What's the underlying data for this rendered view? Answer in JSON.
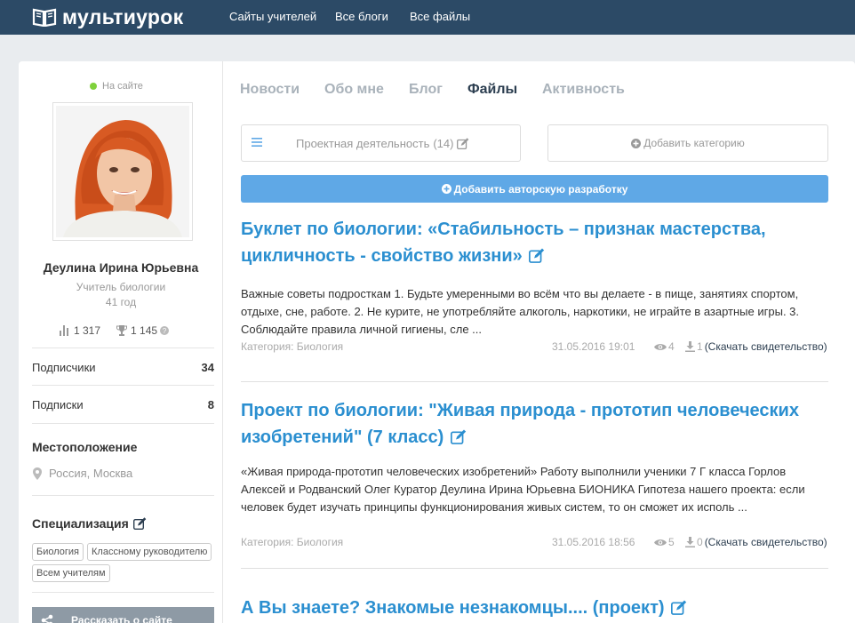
{
  "brand": {
    "name": "мультиурок"
  },
  "topnav": [
    "Сайты учителей",
    "Все блоги",
    "Все файлы"
  ],
  "profile": {
    "status": "На сайте",
    "name": "Деулина Ирина Юрьевна",
    "role": "Учитель биологии",
    "age": "41 год",
    "rating": "1 317",
    "awards": "1 145",
    "subscribers_label": "Подписчики",
    "subscribers": "34",
    "subscriptions_label": "Подписки",
    "subscriptions": "8",
    "location_heading": "Местоположение",
    "location": "Россия, Москва",
    "spec_heading": "Специализация",
    "spec_tags": [
      "Биология",
      "Классному руководителю",
      "Всем учителям"
    ],
    "share_label": "Рассказать о сайте"
  },
  "tabs": [
    "Новости",
    "Обо мне",
    "Блог",
    "Файлы",
    "Активность"
  ],
  "active_tab": "Файлы",
  "category_select": {
    "name": "Проектная деятельность",
    "count": "(14)"
  },
  "add_category_label": "Добавить категорию",
  "add_work_label": "Добавить авторскую разработку",
  "posts": [
    {
      "title": "Буклет по биологии: «Стабильность – признак мастерства, цикличность - свойство жизни»",
      "description": "Важные советы подросткам 1. Будьте умеренными во всём что вы делаете - в пище, занятиях спортом, отдыхе, сне, работе. 2. Не курите, не употребляйте алкоголь, наркотики, не играйте в азартные игры. 3. Соблюдайте правила личной гигиены, сле ...",
      "category": "Категория: Биология",
      "date": "31.05.2016 19:01",
      "views": "4",
      "downloads": "1",
      "cert_label": "(Скачать свидетельство)"
    },
    {
      "title": "Проект по биологии: \"Живая природа - прототип человеческих изобретений\" (7 класс)",
      "description": "«Живая природа-прототип человеческих изобретений» Работу выполнили  ученики 7 Г класса Горлов Алексей и Родванский Олег Куратор Деулина Ирина Юрьевна БИОНИКА Гипотеза нашего проекта: если человек будет изучать принципы функционирования живых систем, то он сможет их исполь ...",
      "category": "Категория: Биология",
      "date": "31.05.2016 18:56",
      "views": "5",
      "downloads": "0",
      "cert_label": "(Скачать свидетельство)"
    },
    {
      "title": "А Вы знаете? Знакомые незнакомцы.... (проект)"
    }
  ],
  "colors": {
    "topbar": "#2c4a66",
    "link": "#2b8fd0",
    "button": "#5fa8e6",
    "online": "#7fd13b"
  },
  "icons": [
    "book-logo-icon",
    "bar-chart-icon",
    "trophy-icon",
    "help-icon",
    "map-pin-icon",
    "edit-icon",
    "menu-icon",
    "plus-circle-icon",
    "eye-icon",
    "download-icon",
    "share-icon"
  ]
}
